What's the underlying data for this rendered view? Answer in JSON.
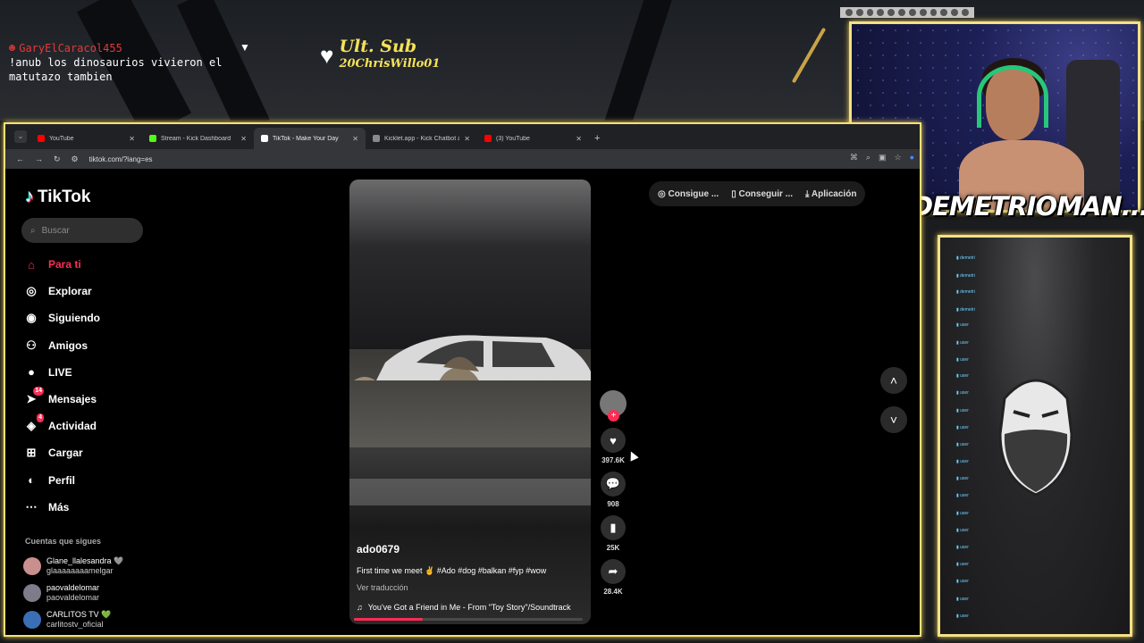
{
  "stream": {
    "chat_user": "GaryElCaracol455",
    "chat_message": "!anub los dinosaurios vivieron el matutazo tambien",
    "sub_title": "Ult. Sub",
    "sub_name": "20ChrisWillo01",
    "streamer_name": "DEMETRIOMAN..."
  },
  "browser": {
    "tabs": [
      {
        "title": "YouTube",
        "color": "#ff0000"
      },
      {
        "title": "Stream - Kick Dashboard",
        "color": "#53fc18"
      },
      {
        "title": "TikTok - Make Your Day",
        "color": "#ffffff"
      },
      {
        "title": "Kicklet.app - Kick Chatbot and",
        "color": "#8a8a8a"
      },
      {
        "title": "(3) YouTube",
        "color": "#ff0000"
      }
    ],
    "new_tab": "+",
    "url": "tiktok.com/?lang=es"
  },
  "tiktok": {
    "logo": "TikTok",
    "search_placeholder": "Buscar",
    "nav": [
      {
        "label": "Para ti",
        "icon": "home-icon"
      },
      {
        "label": "Explorar",
        "icon": "compass-icon"
      },
      {
        "label": "Siguiendo",
        "icon": "following-avatar-icon"
      },
      {
        "label": "Amigos",
        "icon": "friends-icon"
      },
      {
        "label": "LIVE",
        "icon": "live-icon"
      },
      {
        "label": "Mensajes",
        "icon": "messages-icon",
        "badge": "14"
      },
      {
        "label": "Actividad",
        "icon": "activity-icon",
        "badge": "4"
      },
      {
        "label": "Cargar",
        "icon": "upload-icon"
      },
      {
        "label": "Perfil",
        "icon": "profile-icon"
      },
      {
        "label": "Más",
        "icon": "more-icon"
      }
    ],
    "following_header": "Cuentas que sigues",
    "following": [
      {
        "nick": "Glane_llalesandra 🩶",
        "handle": "glaaaaaaaamelgar"
      },
      {
        "nick": "paovaldelomar",
        "handle": "paovaldelomar"
      },
      {
        "nick": "CARLITOS TV 💚",
        "handle": "carlitostv_oficial"
      }
    ],
    "promos": [
      "Consigue ...",
      "Conseguir ...",
      "Aplicación"
    ],
    "video": {
      "author": "ado0679",
      "caption": "First time we meet ✌️ #Ado #dog #balkan #fyp #wow",
      "translate": "Ver traducción",
      "music": "You've Got a Friend in Me - From \"Toy Story\"/Soundtrack",
      "progress": 0.3
    },
    "actions": {
      "likes": "397.6K",
      "comments": "908",
      "saves": "25K",
      "shares": "28.4K"
    }
  }
}
